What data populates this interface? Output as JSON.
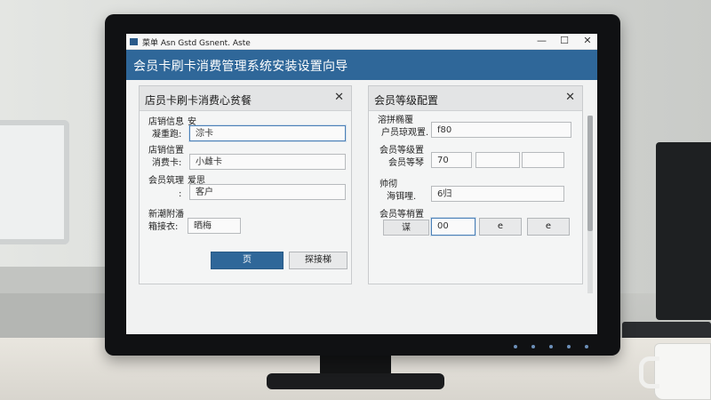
{
  "window": {
    "title": "菜单 Asn Gstd Gsnent. Aste",
    "controls": [
      "—",
      "☐",
      "✕"
    ]
  },
  "app": {
    "title": "会员卡刷卡消费管理系统安装设置向导"
  },
  "left_panel": {
    "title": "店员卡刷卡消费心贫餐",
    "close": "✕",
    "rows": [
      {
        "label1": "店销信息",
        "label1b": "安",
        "label2": "凝重跑:",
        "value": "淙卡"
      },
      {
        "label1": "店销信置",
        "label2": "消费卡:",
        "value": "小雌卡"
      },
      {
        "label1": "会员筑理",
        "label1b": "爱思",
        "label2": ":",
        "value": "客户"
      },
      {
        "label1": "新潮附潘",
        "label2": "箱接衣:",
        "value": "晒梅"
      }
    ],
    "buttons": {
      "primary": "页",
      "secondary": "探接梯"
    }
  },
  "right_panel": {
    "title": "会员等级配置",
    "close": "✕",
    "rows": [
      {
        "label1": "溶拼椭覆",
        "label2": "户员琼观置.",
        "value": "f80"
      },
      {
        "label1": "会员等级置",
        "label2": "会员等琴",
        "values": [
          "70",
          "",
          ""
        ]
      },
      {
        "label1": "帅彻",
        "label2": "海铒哩.",
        "value": "6归"
      },
      {
        "label1": "会员等梢置",
        "label2": "谋",
        "values": [
          "00",
          "e",
          "e"
        ]
      }
    ]
  }
}
